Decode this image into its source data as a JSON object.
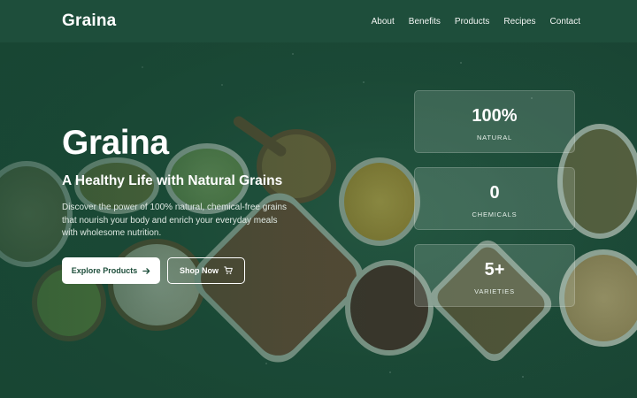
{
  "nav": {
    "logo": "Graina",
    "links": [
      "About",
      "Benefits",
      "Products",
      "Recipes",
      "Contact"
    ]
  },
  "hero": {
    "title": "Graina",
    "subtitle": "A Healthy Life with Natural Grains",
    "description": "Discover the power of 100% natural, chemical-free grains that nourish your body and enrich your everyday meals with wholesome nutrition.",
    "primary_button": "Explore Products",
    "secondary_button": "Shop Now"
  },
  "stats": [
    {
      "value": "100%",
      "label": "NATURAL"
    },
    {
      "value": "0",
      "label": "CHEMICALS"
    },
    {
      "value": "5+",
      "label": "VARIETIES"
    }
  ],
  "icons": {
    "primary_button_icon": "arrow-right-icon",
    "secondary_button_icon": "cart-icon"
  },
  "colors": {
    "brand_green": "#1e4e3b",
    "white": "#ffffff"
  }
}
